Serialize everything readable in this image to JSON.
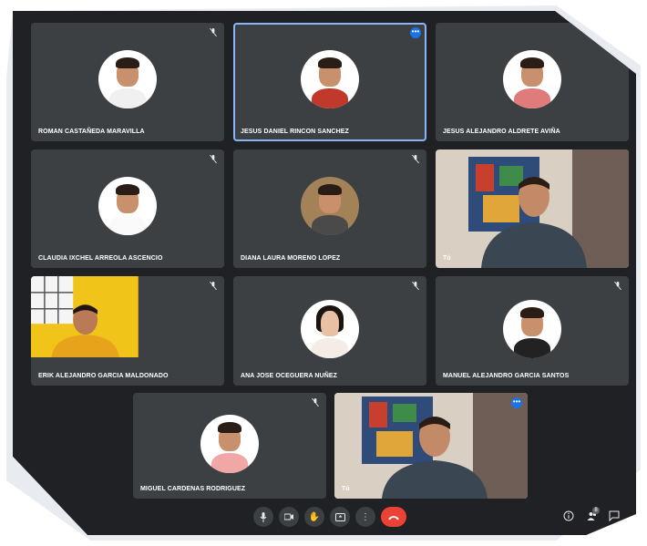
{
  "participants": [
    {
      "name": "ROMAN CASTAÑEDA MARAVILLA"
    },
    {
      "name": "JESUS DANIEL RINCON SANCHEZ"
    },
    {
      "name": "JESUS ALEJANDRO ALDRETE AVIÑA"
    },
    {
      "name": "CLAUDIA IXCHEL ARREOLA ASCENCIO"
    },
    {
      "name": "DIANA LAURA MORENO LOPEZ"
    },
    {
      "name": "Tú"
    },
    {
      "name": "ERIK ALEJANDRO GARCIA MALDONADO"
    },
    {
      "name": "ANA JOSE OCEGUERA NUÑEZ"
    },
    {
      "name": "MANUEL ALEJANDRO GARCIA SANTOS"
    },
    {
      "name": "MIGUEL CARDENAS RODRIGUEZ"
    },
    {
      "name": "Tú"
    }
  ],
  "toolbar": {
    "participant_count": "8"
  },
  "colors": {
    "background": "#202124",
    "tile": "#3c4043",
    "active_outline": "#8ab4f8",
    "end_call": "#ea4335",
    "badge": "#1a73e8"
  },
  "icons": [
    "mic-icon",
    "camera-icon",
    "raise-hand-icon",
    "present-icon",
    "more-icon",
    "end-call-icon",
    "info-icon",
    "people-icon",
    "chat-icon"
  ]
}
